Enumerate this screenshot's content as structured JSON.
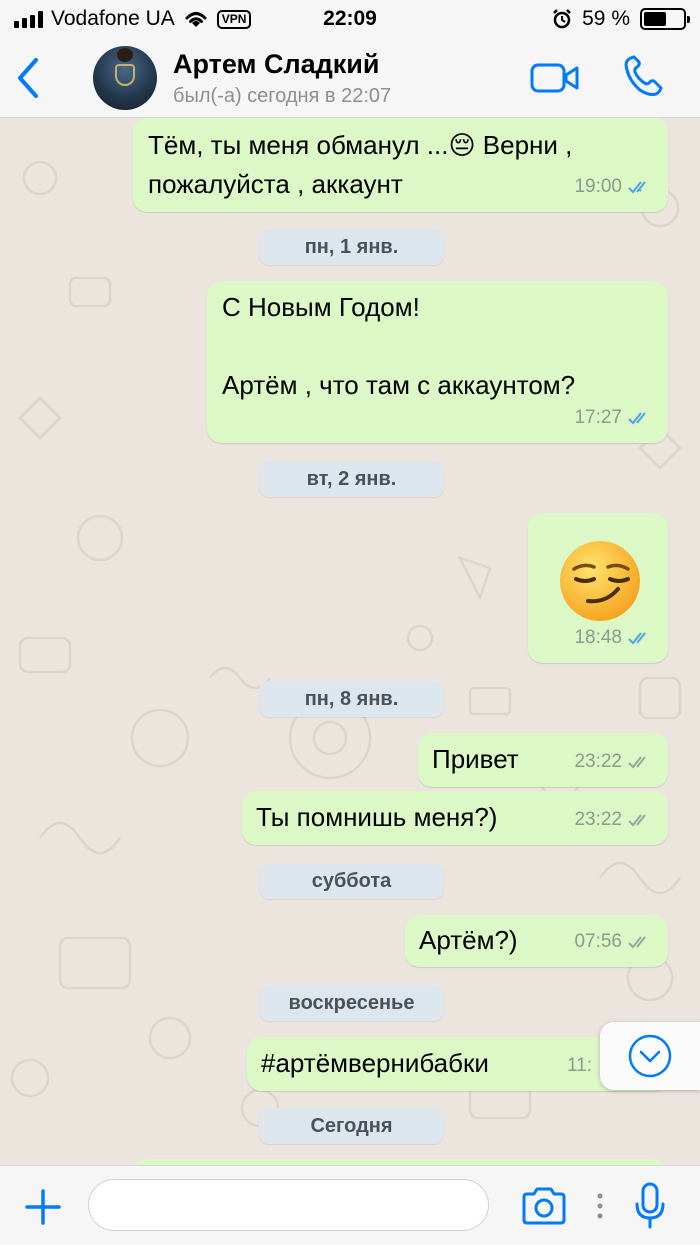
{
  "status_bar": {
    "carrier": "Vodafone UA",
    "vpn": "VPN",
    "time": "22:09",
    "battery": "59 %",
    "battery_level": 0.59
  },
  "header": {
    "contact_name": "Артем Сладкий",
    "last_seen": "был(-а) сегодня в 22:07"
  },
  "messages": [
    {
      "kind": "out",
      "lines": [
        "Тём, ты меня обманул ...😔 Верни ,",
        "пожалуйста , аккаунт"
      ],
      "time": "19:00",
      "status": "read"
    },
    {
      "kind": "date",
      "label": "пн, 1 янв."
    },
    {
      "kind": "out",
      "lines": [
        "С Новым Годом!",
        "",
        "Артём , что там с аккаунтом?"
      ],
      "time": "17:27",
      "status": "read"
    },
    {
      "kind": "date",
      "label": "вт, 2 янв."
    },
    {
      "kind": "out-emoji",
      "emoji": "smirking-face",
      "time": "18:48",
      "status": "read"
    },
    {
      "kind": "date",
      "label": "пн, 8 янв."
    },
    {
      "kind": "out",
      "lines": [
        "Привет"
      ],
      "time": "23:22",
      "status": "delivered"
    },
    {
      "kind": "out",
      "lines": [
        "Ты помнишь меня?)"
      ],
      "time": "23:22",
      "status": "delivered"
    },
    {
      "kind": "date",
      "label": "суббота"
    },
    {
      "kind": "out",
      "lines": [
        "Артём?)"
      ],
      "time": "07:56",
      "status": "delivered"
    },
    {
      "kind": "date",
      "label": "воскресенье"
    },
    {
      "kind": "out",
      "lines": [
        "#артёмвернибабки"
      ],
      "time": "11:",
      "status": "delivered"
    },
    {
      "kind": "date",
      "label": "Сегодня"
    }
  ],
  "input": {
    "placeholder": ""
  },
  "colors": {
    "accent": "#007aff",
    "bubble_out": "#dcf8c6",
    "chat_bg": "#ece5dd",
    "read_ticks": "#4fa3e8",
    "delivered_ticks": "#9aa69a"
  }
}
